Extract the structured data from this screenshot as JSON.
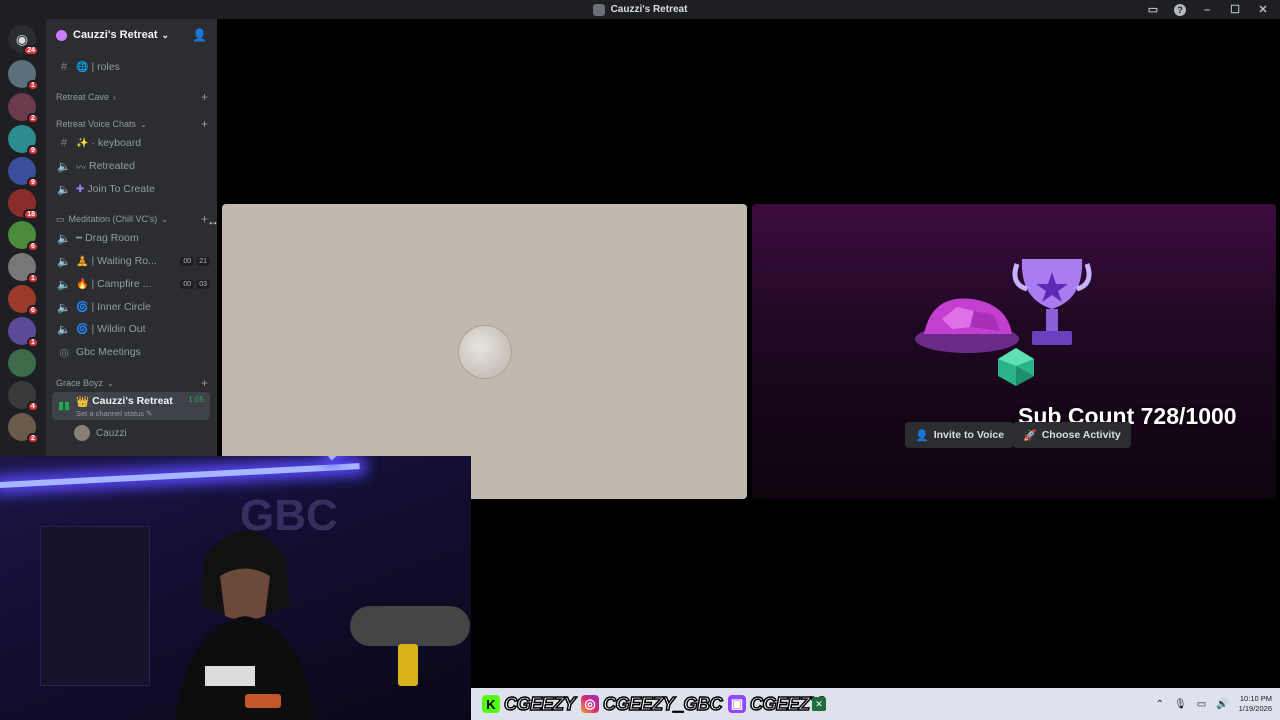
{
  "window": {
    "title": "Cauzzi's Retreat"
  },
  "guild_rail": {
    "home_badge": "24",
    "guilds": [
      {
        "badge": "1",
        "color": "#5c6f7d"
      },
      {
        "badge": "2",
        "color": "#6b3a4d"
      },
      {
        "badge": "9",
        "color": "#2d8c8f"
      },
      {
        "badge": "9",
        "color": "#3a4e9c"
      },
      {
        "badge": "18",
        "color": "#8c2b2b"
      },
      {
        "badge": "6",
        "color": "#4c8a3c"
      },
      {
        "badge": "1",
        "color": "#777777"
      },
      {
        "badge": "6",
        "color": "#9a3a2a"
      },
      {
        "badge": "1",
        "color": "#5b4a9a"
      },
      {
        "badge": "",
        "color": "#3b6b4a"
      },
      {
        "badge": "4",
        "color": "#3a3a3a"
      },
      {
        "badge": "2",
        "color": "#6a5a4a"
      }
    ]
  },
  "sidebar": {
    "server_name": "Cauzzi's Retreat",
    "channels": {
      "roles": "| roles",
      "keyboard": "· keyboard",
      "retreated": "Retreated",
      "join_to_create": "Join To Create",
      "drag_room": "Drag Room",
      "waiting_room": "| Waiting Ro...",
      "campfire": "| Campfire ...",
      "inner_circle": "| Inner Circle",
      "wildin_out": "| Wildin Out",
      "gbc_meetings": "Gbc Meetings"
    },
    "categories": {
      "retreat_cave": "Retreat Cave",
      "retreat_voice_chats": "Retreat Voice Chats",
      "meditation": "Meditation (Chill VC's)",
      "grace_boyz": "Grace Boyz"
    },
    "counts": {
      "waiting_a": "00",
      "waiting_b": "21",
      "campfire_a": "00",
      "campfire_b": "03"
    },
    "active_channel": {
      "name": "Cauzzi's Retreat",
      "time": "1:05",
      "status": "Set a channel status"
    },
    "connected_user": "Cauzzi"
  },
  "stage": {
    "sub_count": "Sub Count 728/1000",
    "invite_button": "Invite to Voice",
    "activity_button": "Choose Activity"
  },
  "overlay": {
    "kick_handle": "CGEEZY",
    "instagram_handle": "CGEEZY_GBC",
    "twitch_handle": "CGEEZY"
  },
  "taskbar": {
    "time": "10:10 PM",
    "date": "1/19/2026"
  },
  "colors": {
    "discord_bg": "#2b2d31",
    "rail_bg": "#1e1f22",
    "online_green": "#23a55a",
    "badge_red": "#da373c"
  }
}
